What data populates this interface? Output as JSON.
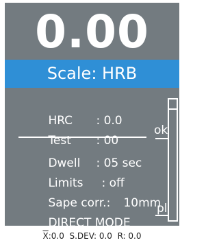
{
  "display": {
    "reading": "0.00",
    "scale_label": "Scale: HRB",
    "rows": [
      {
        "label": "HRC",
        "value": ": 0.0"
      },
      {
        "label": "Test",
        "value": ": 00"
      },
      {
        "label": "Dwell",
        "value": ": 05 sec"
      },
      {
        "label": "Limits",
        "value": ": off"
      },
      {
        "label": "Sape corr.:",
        "value": "10mm"
      },
      {
        "label": "DIRECT MODE",
        "value": ""
      }
    ],
    "gauge": {
      "upper_label": "ok",
      "lower_label": "pl"
    }
  },
  "statistics": {
    "mean_symbol": "X",
    "mean": ":0.0",
    "sdev": "S.DEV: 0.0",
    "range": "R: 0.0"
  },
  "colors": {
    "screen_bg": "#737b80",
    "scale_bar": "#2f8fd6",
    "text": "#ffffff"
  }
}
